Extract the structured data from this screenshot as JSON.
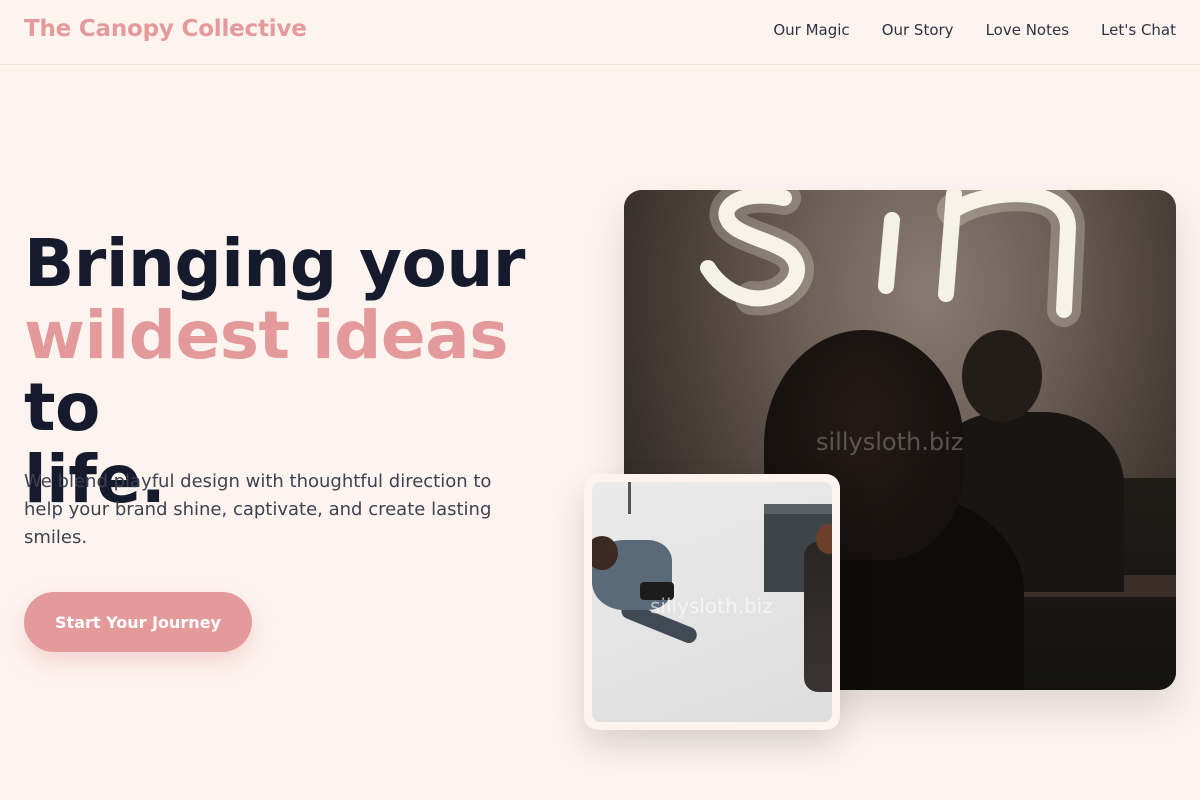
{
  "header": {
    "brand": "The Canopy Collective",
    "nav": [
      "Our Magic",
      "Our Story",
      "Love Notes",
      "Let's Chat"
    ]
  },
  "hero": {
    "headline_part1": "Bringing your",
    "headline_accent": "wildest ideas",
    "headline_part2": "to",
    "headline_part3": "life.",
    "subtitle": "We blend playful design with thoughtful direction to help your brand shine, captivate, and create lasting smiles.",
    "cta_label": "Start Your Journey"
  },
  "images": {
    "main_watermark": "sillysloth.biz",
    "small_watermark": "sillysloth.biz"
  },
  "colors": {
    "background": "#fdf4f0",
    "accent": "#e49a9a",
    "text_dark": "#151a2d"
  }
}
